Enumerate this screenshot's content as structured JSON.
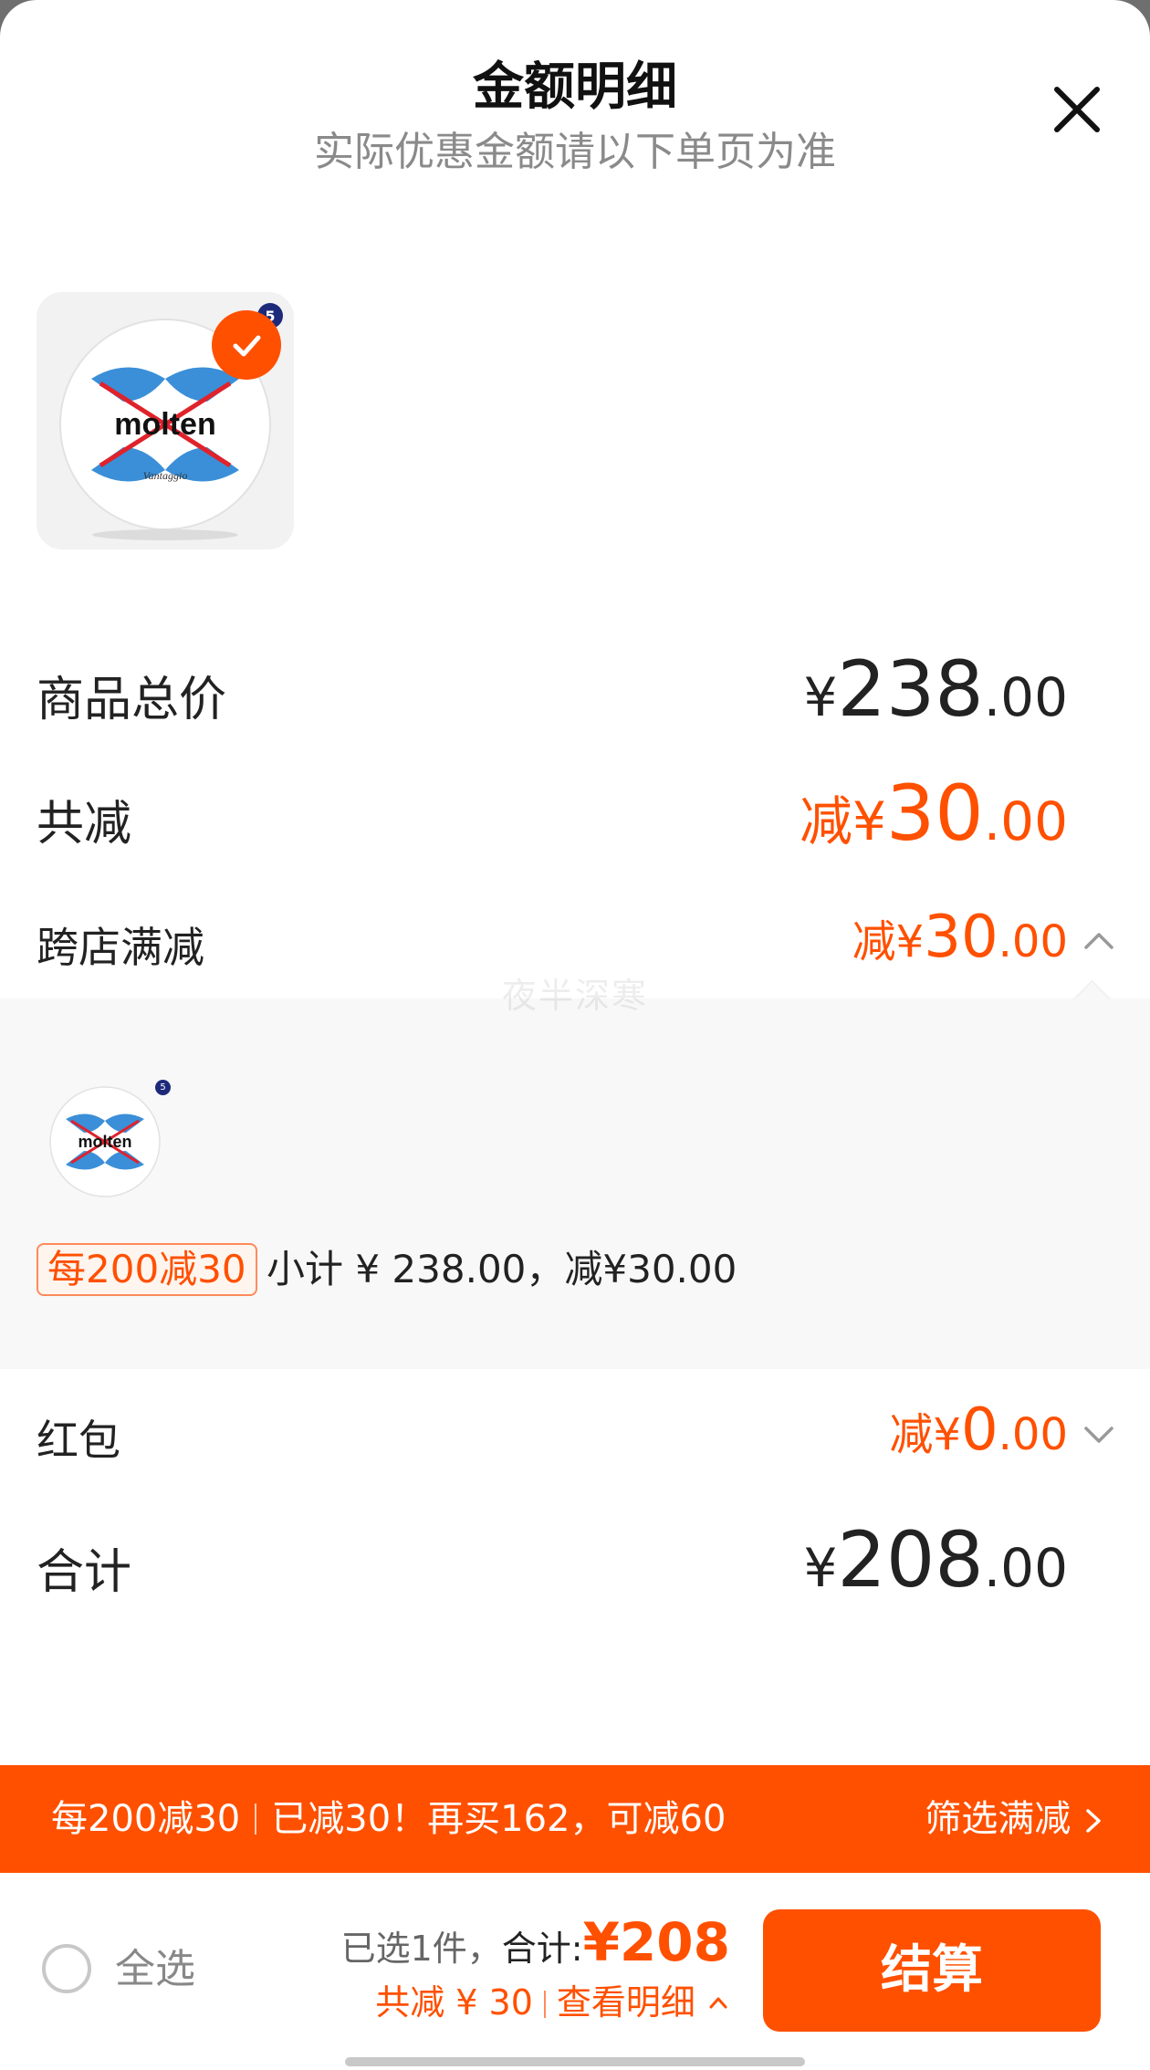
{
  "header": {
    "title": "金额明细",
    "subtitle": "实际优惠金额请以下单页为准"
  },
  "product": {
    "brand": "molten",
    "model": "Vantaggio",
    "size_badge": "5",
    "selected": true
  },
  "rows": {
    "goods_total": {
      "label": "商品总价",
      "yen": "¥",
      "int": "238",
      "dec": ".00"
    },
    "total_discount": {
      "label": "共减",
      "prefix": "减¥",
      "int": "30",
      "dec": ".00"
    },
    "cross_store": {
      "label": "跨店满减",
      "prefix": "减¥",
      "int": "30",
      "dec": ".00",
      "expanded": true
    },
    "red_packet": {
      "label": "红包",
      "prefix": "减¥",
      "int": "0",
      "dec": ".00",
      "expanded": false
    },
    "total": {
      "label": "合计",
      "yen": "¥",
      "int": "208",
      "dec": ".00"
    }
  },
  "detail_panel": {
    "promo_tag": "每200减30",
    "promo_text": "小计 ¥ 238.00，减¥30.00",
    "watermark": "夜半深寒"
  },
  "banner": {
    "part1": "每200减30",
    "part2": "已减30！再买162，可减60",
    "filter_label": "筛选满减",
    "filter_arrow": ">"
  },
  "footer": {
    "select_all": "全选",
    "selected_count": "已选1件，",
    "total_label": "合计:",
    "total_value": "¥208",
    "discount_summary": "共减 ¥ 30",
    "view_detail": "查看明细",
    "view_detail_arrow": "^",
    "checkout_label": "结算"
  },
  "colors": {
    "accent": "#ff5000",
    "text": "#222222",
    "muted": "#8a8a8a"
  }
}
